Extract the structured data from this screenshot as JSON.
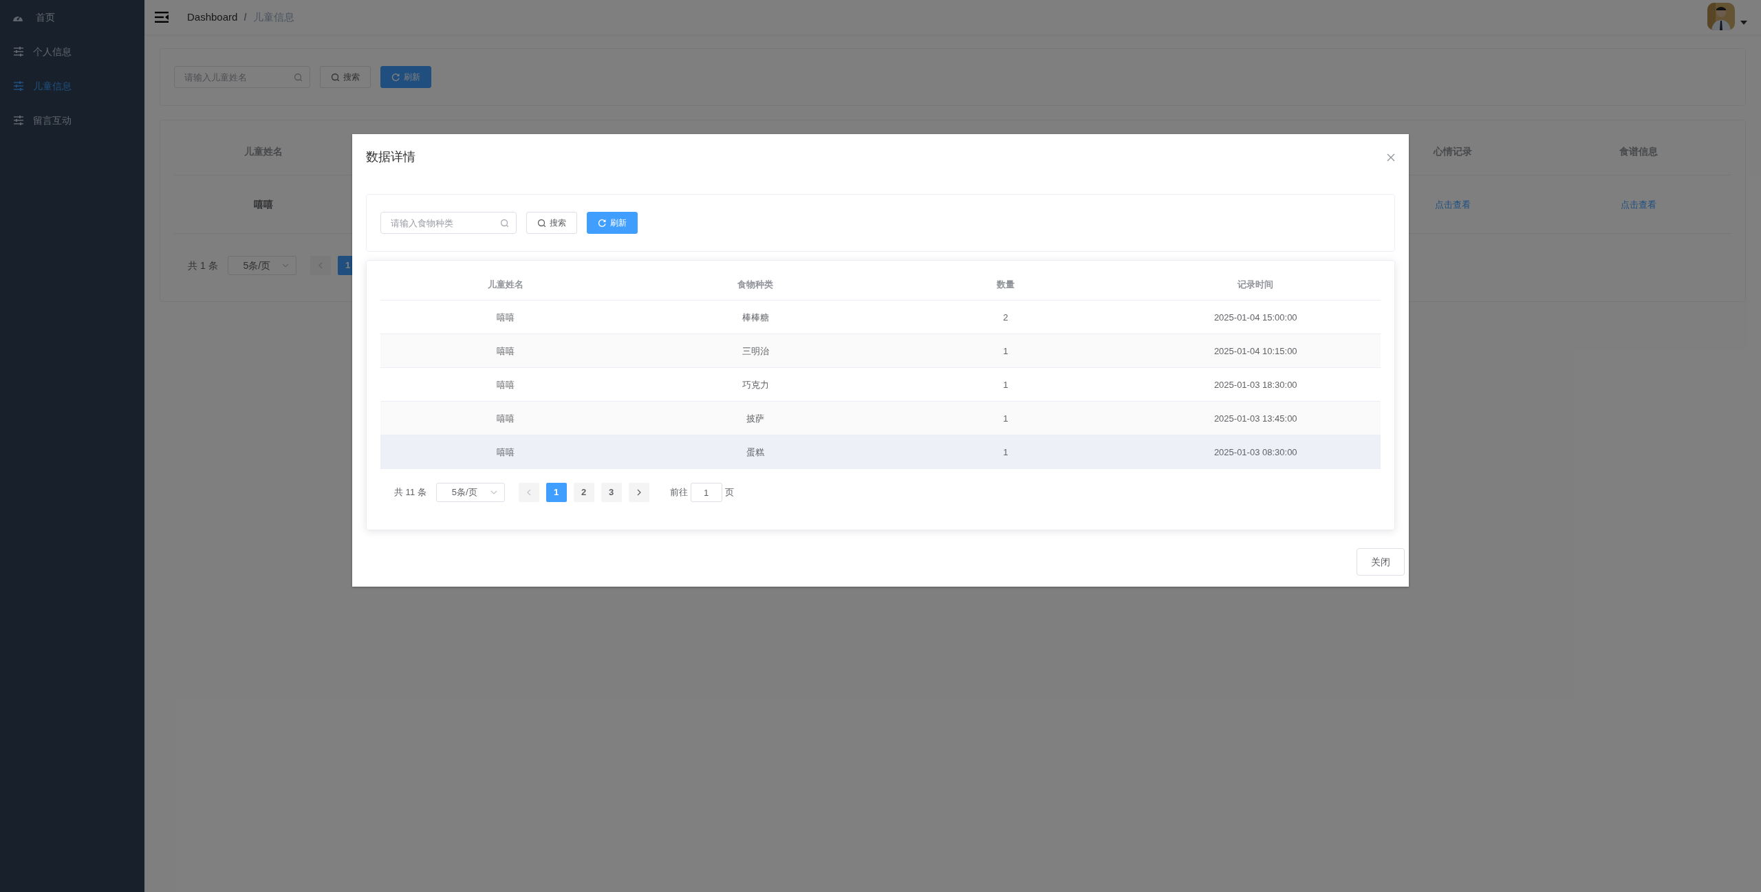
{
  "sidebar": {
    "items": [
      {
        "kind": "gauge",
        "label": "首页",
        "selected": false
      },
      {
        "kind": "sliders",
        "label": "个人信息",
        "selected": false
      },
      {
        "kind": "sliders",
        "label": "儿童信息",
        "selected": true
      },
      {
        "kind": "sliders",
        "label": "留言互动",
        "selected": false
      }
    ]
  },
  "breadcrumb": {
    "items": [
      "Dashboard",
      "儿童信息"
    ],
    "separator": "/"
  },
  "search": {
    "placeholder": "请输入儿童姓名",
    "buttons": [
      {
        "kind": "search",
        "label": "搜索"
      },
      {
        "kind": "refresh",
        "label": "刷新"
      }
    ]
  },
  "table": {
    "columns": [
      "儿童姓名",
      "心情记录",
      "食谱信息"
    ],
    "rows": [
      [
        {
          "kind": "text",
          "text": "嘻嘻"
        },
        {
          "kind": "link",
          "text": "点击查看"
        },
        {
          "kind": "link",
          "text": "点击查看"
        }
      ]
    ]
  },
  "pagination": {
    "total": "共 1 条",
    "page_size": "5条/页",
    "pages": [
      {
        "label": "1",
        "selected": true
      }
    ]
  },
  "dialog": {
    "title": "数据详情",
    "search": {
      "placeholder": "请输入食物种类",
      "buttons": [
        {
          "kind": "search",
          "label": "搜索"
        },
        {
          "kind": "refresh",
          "label": "刷新"
        }
      ]
    },
    "table": {
      "columns": [
        "儿童姓名",
        "食物种类",
        "数量",
        "记录时间"
      ],
      "rows": [
        {
          "cells": [
            "嘻嘻",
            "棒棒糖",
            "2",
            "2025-01-04 15:00:00"
          ],
          "highlighted": false
        },
        {
          "cells": [
            "嘻嘻",
            "三明治",
            "1",
            "2025-01-04 10:15:00"
          ],
          "highlighted": false
        },
        {
          "cells": [
            "嘻嘻",
            "巧克力",
            "1",
            "2025-01-03 18:30:00"
          ],
          "highlighted": false
        },
        {
          "cells": [
            "嘻嘻",
            "披萨",
            "1",
            "2025-01-03 13:45:00"
          ],
          "highlighted": false
        },
        {
          "cells": [
            "嘻嘻",
            "蛋糕",
            "1",
            "2025-01-03 08:30:00"
          ],
          "highlighted": true
        }
      ]
    },
    "pagination": {
      "total": "共 11 条",
      "page_size": "5条/页",
      "pages": [
        {
          "label": "1",
          "selected": true
        },
        {
          "label": "2",
          "selected": false
        },
        {
          "label": "3",
          "selected": false
        }
      ],
      "goto_label": "前往",
      "goto_value": "1",
      "goto_suffix": "页"
    },
    "footer_button": "关闭"
  }
}
